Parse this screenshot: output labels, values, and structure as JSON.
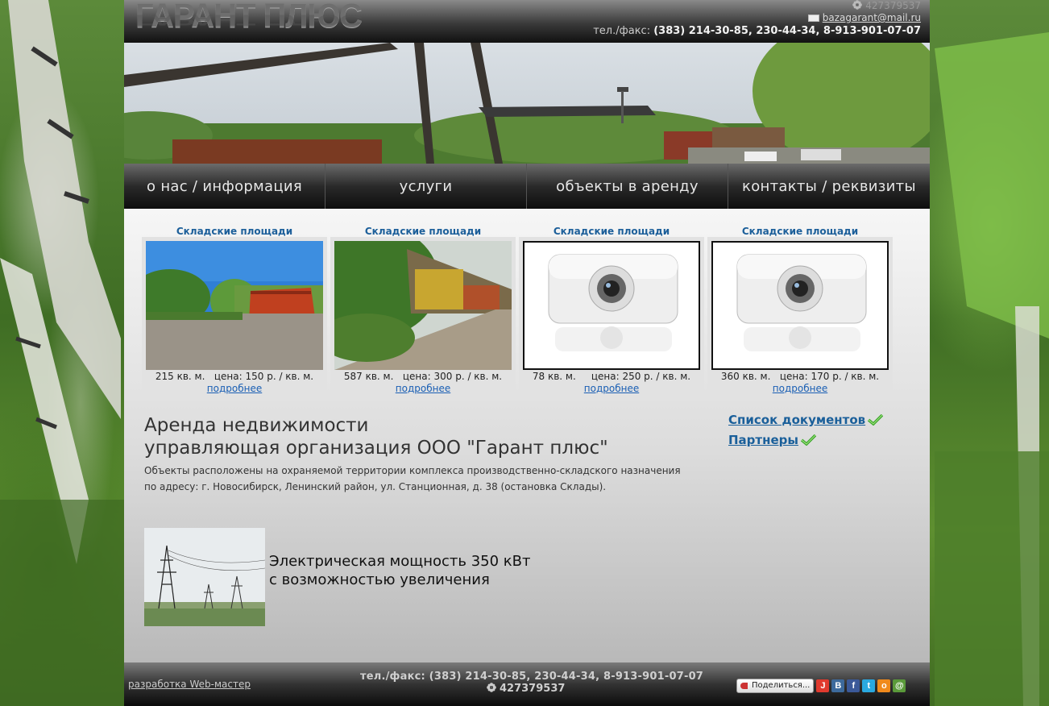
{
  "header": {
    "logo": "ГАРАНТ ПЛЮС",
    "icq": "427379537",
    "email": "bazagarant@mail.ru",
    "phone_label": "тел./факс:",
    "phone_numbers": "(383) 214-30-85, 230-44-34, 8-913-901-07-07"
  },
  "nav": [
    {
      "label": "о нас / информация"
    },
    {
      "label": "услуги"
    },
    {
      "label": "объекты в аренду"
    },
    {
      "label": "контакты / реквизиты"
    }
  ],
  "cards": [
    {
      "title": "Складские площади",
      "area": "215 кв. м.",
      "price": "цена: 150 р. / кв. м.",
      "more": "подробнее",
      "photo": "red-warehouse"
    },
    {
      "title": "Складские площади",
      "area": "587 кв. м.",
      "price": "цена: 300 р. / кв. м.",
      "more": "подробнее",
      "photo": "yellow-warehouse"
    },
    {
      "title": "Складские площади",
      "area": "78 кв. м.",
      "price": "цена: 250 р. / кв. м.",
      "more": "подробнее",
      "photo": "camera-placeholder"
    },
    {
      "title": "Складские площади",
      "area": "360 кв. м.",
      "price": "цена: 170 р. / кв. м.",
      "more": "подробнее",
      "photo": "camera-placeholder"
    }
  ],
  "main": {
    "title_line1": "Аренда недвижимости",
    "title_line2": "управляющая организация ООО \"Гарант плюс\"",
    "desc_line1": "Объекты расположены на охраняемой территории комплекса производственно-складского назначения",
    "desc_line2": "по адресу: г. Новосибирск, Ленинский район, ул. Станционная, д. 38 (остановка Склады).",
    "power_line1": "Электрическая мощность 350 кВт",
    "power_line2": "с возможностью увеличения"
  },
  "side_links": {
    "documents": "Список документов",
    "partners": "Партнеры"
  },
  "footer": {
    "developer": "разработка Web-мастер",
    "phone": "тел./факс: (383) 214-30-85, 230-44-34, 8-913-901-07-07",
    "icq": "427379537",
    "share_label": "Поделиться...",
    "social": [
      {
        "name": "livejournal",
        "glyph": "J",
        "color": "#e03a2e"
      },
      {
        "name": "vkontakte",
        "glyph": "B",
        "color": "#3d6a9c"
      },
      {
        "name": "facebook",
        "glyph": "f",
        "color": "#3b5998"
      },
      {
        "name": "twitter",
        "glyph": "t",
        "color": "#2aa9e0"
      },
      {
        "name": "odnoklassniki",
        "glyph": "o",
        "color": "#f08a1c"
      },
      {
        "name": "moimir",
        "glyph": "@",
        "color": "#5a9a3a"
      }
    ]
  }
}
